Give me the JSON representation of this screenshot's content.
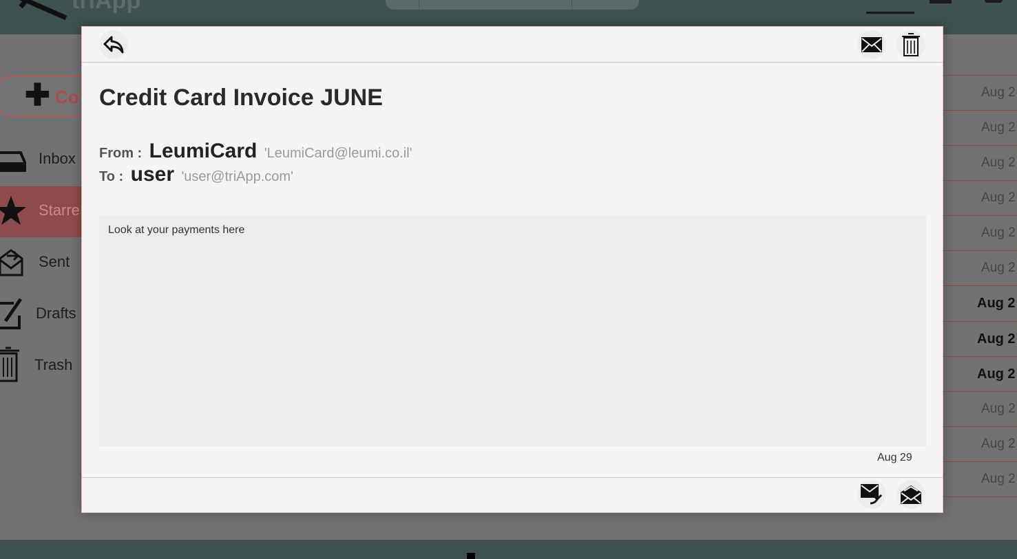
{
  "app": {
    "name": "triApp"
  },
  "sidebar": {
    "compose_label": "Co",
    "items": [
      {
        "label": "Inbox",
        "icon": "inbox-icon"
      },
      {
        "label": "Starre",
        "icon": "star-icon",
        "active": true
      },
      {
        "label": "Sent",
        "icon": "sent-icon"
      },
      {
        "label": "Drafts",
        "icon": "drafts-icon"
      },
      {
        "label": "Trash",
        "icon": "trash-icon"
      }
    ]
  },
  "mail_list": {
    "rows": [
      {
        "date": "Aug 2",
        "unread": false
      },
      {
        "date": "Aug 2",
        "unread": false
      },
      {
        "date": "Aug 2",
        "unread": false
      },
      {
        "date": "Aug 2",
        "unread": false
      },
      {
        "date": "Aug 2",
        "unread": false
      },
      {
        "date": "Aug 2",
        "unread": false
      },
      {
        "date": "Aug 2",
        "unread": true
      },
      {
        "date": "Aug 2",
        "unread": true
      },
      {
        "date": "Aug 2",
        "unread": true
      },
      {
        "date": "Aug 2",
        "unread": false
      },
      {
        "date": "Aug 2",
        "unread": false
      },
      {
        "date": "Aug 2",
        "unread": false
      }
    ]
  },
  "email": {
    "subject": "Credit Card Invoice JUNE",
    "from_label": "From :",
    "from_name": "LeumiCard",
    "from_address": "'LeumiCard@leumi.co.il'",
    "to_label": "To :",
    "to_name": "user",
    "to_address": "'user@triApp.com'",
    "body": "Look at your payments here",
    "date": "Aug 29"
  },
  "toolbar": {
    "top_left": [
      "reply-icon"
    ],
    "top_right": [
      "mark-unread-icon",
      "trash-icon"
    ],
    "bottom_right": [
      "reply-mail-icon",
      "open-mail-icon"
    ]
  },
  "colors": {
    "header_bg": "#3f5250",
    "modal_bg": "#f4f4f4",
    "accent": "#b35a5a"
  }
}
